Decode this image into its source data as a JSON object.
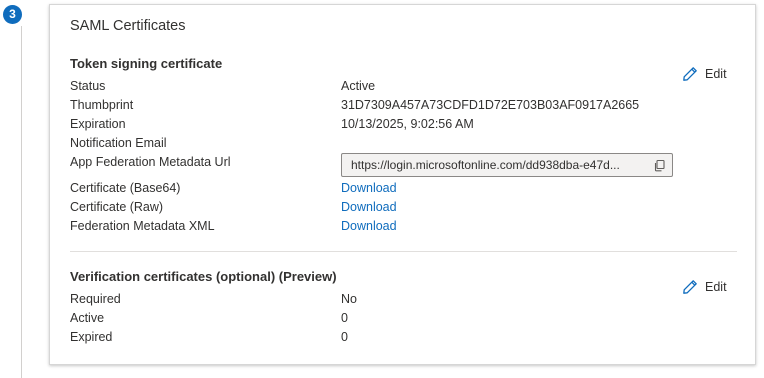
{
  "step": {
    "number": "3"
  },
  "card": {
    "title": "SAML Certificates"
  },
  "token_signing": {
    "title": "Token signing certificate",
    "edit_label": "Edit",
    "rows": [
      {
        "label": "Status",
        "value": "Active"
      },
      {
        "label": "Thumbprint",
        "value": "31D7309A457A73CDFD1D72E703B03AF0917A2665"
      },
      {
        "label": "Expiration",
        "value": "10/13/2025, 9:02:56 AM"
      },
      {
        "label": "Notification Email",
        "value": ""
      },
      {
        "label": "App Federation Metadata Url",
        "value": "https://login.microsoftonline.com/dd938dba-e47d..."
      },
      {
        "label": "Certificate (Base64)",
        "value": "Download"
      },
      {
        "label": "Certificate (Raw)",
        "value": "Download"
      },
      {
        "label": "Federation Metadata XML",
        "value": "Download"
      }
    ]
  },
  "verification": {
    "title": "Verification certificates (optional) (Preview)",
    "edit_label": "Edit",
    "rows": [
      {
        "label": "Required",
        "value": "No"
      },
      {
        "label": "Active",
        "value": "0"
      },
      {
        "label": "Expired",
        "value": "0"
      }
    ]
  },
  "icons": {
    "edit": "pencil-icon",
    "copy": "copy-icon"
  },
  "colors": {
    "accent": "#0f6cbd",
    "text": "#323130",
    "border": "#d6d6d6"
  }
}
